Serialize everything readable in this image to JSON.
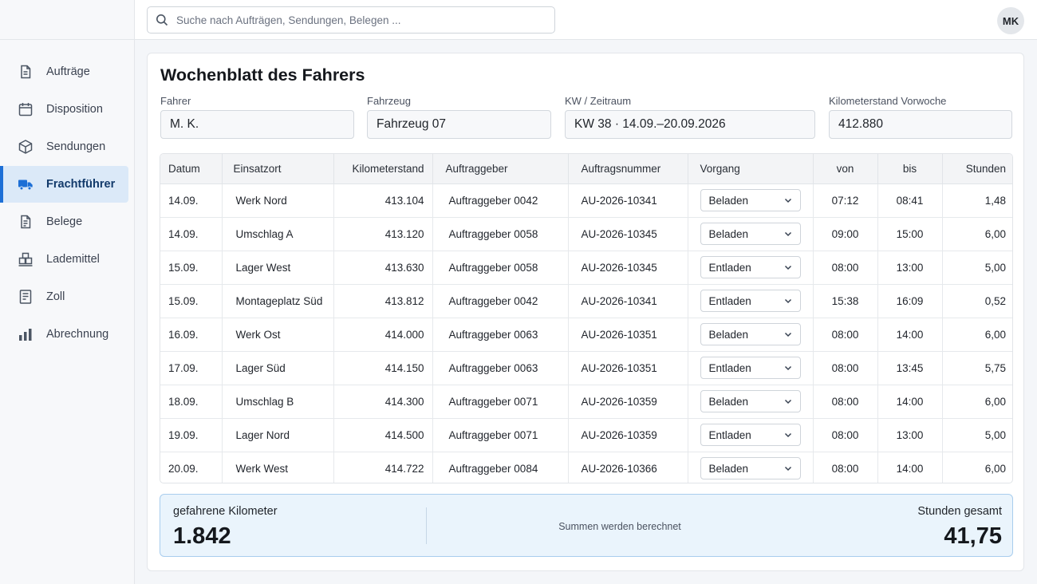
{
  "search": {
    "placeholder": "Suche nach Aufträgen, Sendungen, Belegen ..."
  },
  "user": {
    "initials": "MK"
  },
  "sidebar": {
    "items": [
      {
        "label": "Aufträge",
        "icon": "document-icon",
        "active": false
      },
      {
        "label": "Disposition",
        "icon": "calendar-icon",
        "active": false
      },
      {
        "label": "Sendungen",
        "icon": "package-icon",
        "active": false
      },
      {
        "label": "Frachtführer",
        "icon": "truck-icon",
        "active": true
      },
      {
        "label": "Belege",
        "icon": "receipt-icon",
        "active": false
      },
      {
        "label": "Lademittel",
        "icon": "pallet-boxes-icon",
        "active": false
      },
      {
        "label": "Zoll",
        "icon": "customs-document-icon",
        "active": false
      },
      {
        "label": "Abrechnung",
        "icon": "bar-chart-icon",
        "active": false
      }
    ]
  },
  "page": {
    "title": "Wochenblatt des Fahrers"
  },
  "fields": {
    "fahrer": {
      "label": "Fahrer",
      "value": "M. K."
    },
    "fahrzeug": {
      "label": "Fahrzeug",
      "value": "Fahrzeug 07"
    },
    "zeitraum": {
      "label": "KW / Zeitraum",
      "value": "KW 38 · 14.09.–20.09.2026"
    },
    "km_vorwoche": {
      "label": "Kilometerstand Vorwoche",
      "value": "412.880"
    }
  },
  "table": {
    "columns": [
      "Datum",
      "Einsatzort",
      "Kilometerstand",
      "Auftraggeber",
      "Auftragsnummer",
      "Vorgang",
      "von",
      "bis",
      "Stunden"
    ],
    "rows": [
      {
        "datum": "14.09.",
        "ort": "Werk Nord",
        "km": "413.104",
        "auftraggeber": "Auftraggeber 0042",
        "nummer": "AU-2026-10341",
        "vorgang": "Beladen",
        "von": "07:12",
        "bis": "08:41",
        "stunden": "1,48"
      },
      {
        "datum": "14.09.",
        "ort": "Umschlag A",
        "km": "413.120",
        "auftraggeber": "Auftraggeber 0058",
        "nummer": "AU-2026-10345",
        "vorgang": "Beladen",
        "von": "09:00",
        "bis": "15:00",
        "stunden": "6,00"
      },
      {
        "datum": "15.09.",
        "ort": "Lager West",
        "km": "413.630",
        "auftraggeber": "Auftraggeber 0058",
        "nummer": "AU-2026-10345",
        "vorgang": "Entladen",
        "von": "08:00",
        "bis": "13:00",
        "stunden": "5,00"
      },
      {
        "datum": "15.09.",
        "ort": "Montageplatz Süd",
        "km": "413.812",
        "auftraggeber": "Auftraggeber 0042",
        "nummer": "AU-2026-10341",
        "vorgang": "Entladen",
        "von": "15:38",
        "bis": "16:09",
        "stunden": "0,52"
      },
      {
        "datum": "16.09.",
        "ort": "Werk Ost",
        "km": "414.000",
        "auftraggeber": "Auftraggeber 0063",
        "nummer": "AU-2026-10351",
        "vorgang": "Beladen",
        "von": "08:00",
        "bis": "14:00",
        "stunden": "6,00"
      },
      {
        "datum": "17.09.",
        "ort": "Lager Süd",
        "km": "414.150",
        "auftraggeber": "Auftraggeber 0063",
        "nummer": "AU-2026-10351",
        "vorgang": "Entladen",
        "von": "08:00",
        "bis": "13:45",
        "stunden": "5,75"
      },
      {
        "datum": "18.09.",
        "ort": "Umschlag B",
        "km": "414.300",
        "auftraggeber": "Auftraggeber 0071",
        "nummer": "AU-2026-10359",
        "vorgang": "Beladen",
        "von": "08:00",
        "bis": "14:00",
        "stunden": "6,00"
      },
      {
        "datum": "19.09.",
        "ort": "Lager Nord",
        "km": "414.500",
        "auftraggeber": "Auftraggeber 0071",
        "nummer": "AU-2026-10359",
        "vorgang": "Entladen",
        "von": "08:00",
        "bis": "13:00",
        "stunden": "5,00"
      },
      {
        "datum": "20.09.",
        "ort": "Werk West",
        "km": "414.722",
        "auftraggeber": "Auftraggeber 0084",
        "nummer": "AU-2026-10366",
        "vorgang": "Beladen",
        "von": "08:00",
        "bis": "14:00",
        "stunden": "6,00"
      }
    ]
  },
  "summary": {
    "km_label": "gefahrene Kilometer",
    "km_value": "1.842",
    "note": "Summen werden berechnet",
    "hours_label": "Stunden gesamt",
    "hours_value": "41,75"
  },
  "colors": {
    "accent": "#1d6fd6",
    "active_nav_bg": "#dbe9f8",
    "summary_bg": "#eaf4fc",
    "summary_border": "#a9cdee"
  }
}
